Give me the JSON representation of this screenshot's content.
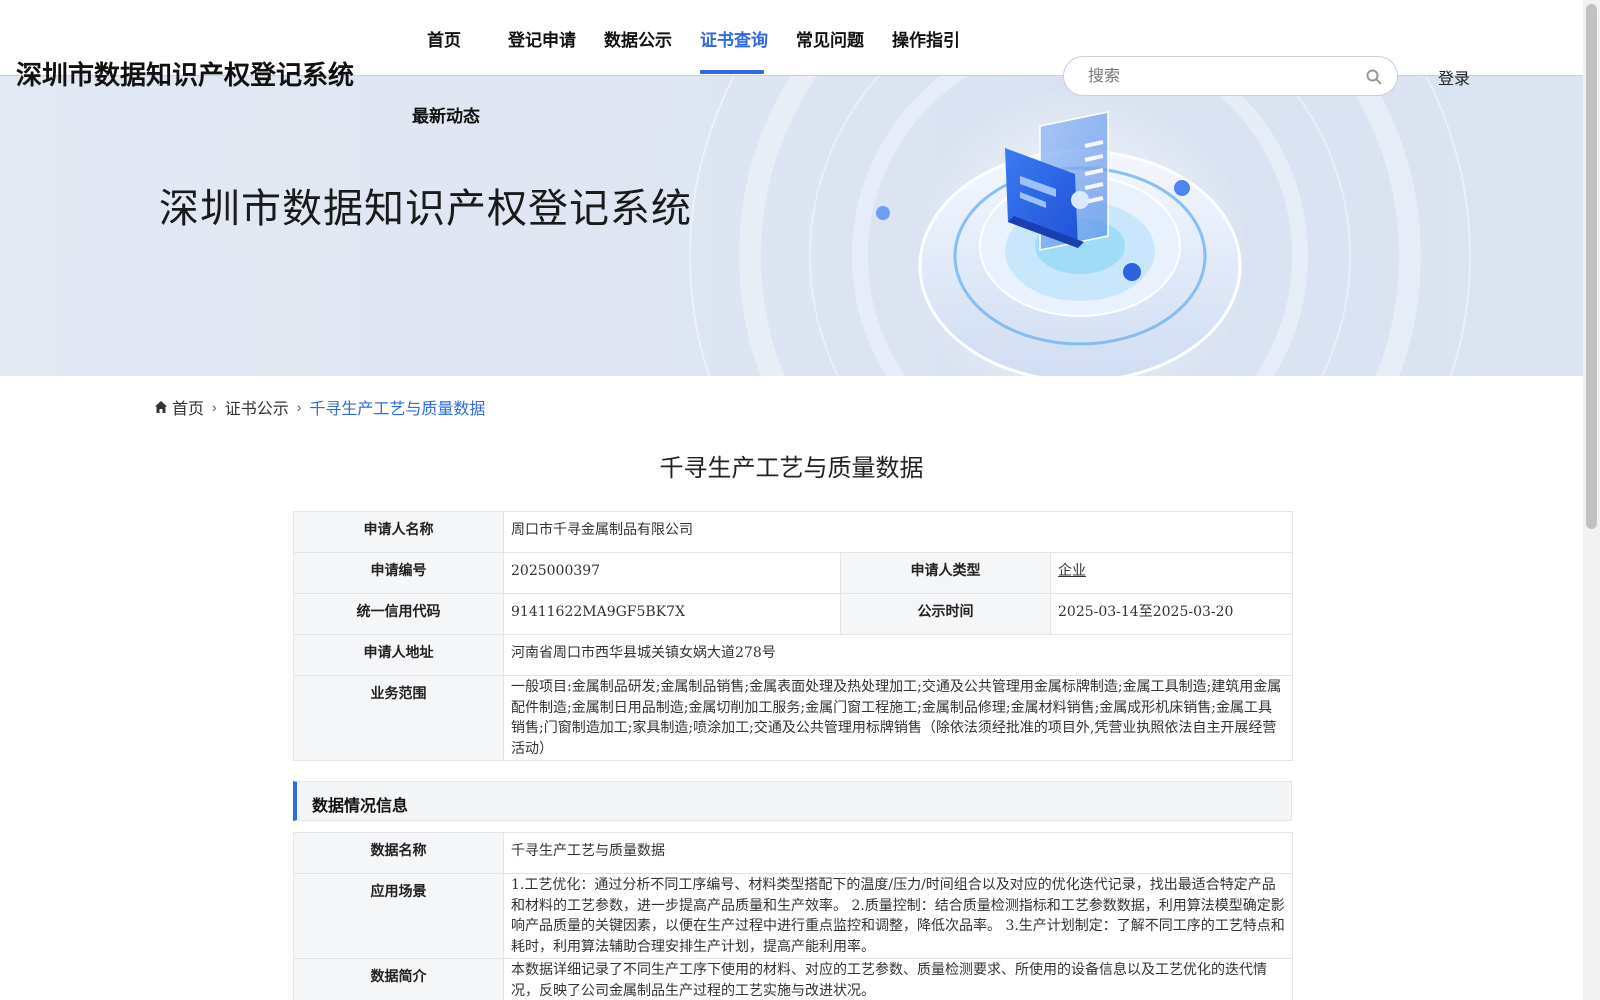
{
  "header": {
    "site_title": "深圳市数据知识产权登记系统",
    "nav": [
      "首页",
      "登记申请",
      "数据公示",
      "证书查询",
      "常见问题",
      "操作指引",
      "最新动态"
    ],
    "active_nav": "证书查询",
    "search_placeholder": "搜索",
    "login": "登录"
  },
  "banner": {
    "title": "深圳市数据知识产权登记系统"
  },
  "breadcrumb": {
    "home": "首页",
    "level2": "证书公示",
    "current": "千寻生产工艺与质量数据"
  },
  "page_title": "千寻生产工艺与质量数据",
  "applicant": {
    "name_label": "申请人名称",
    "name": "周口市千寻金属制品有限公司",
    "number_label": "申请编号",
    "number": "2025000397",
    "type_label": "申请人类型",
    "type": "企业",
    "credit_label": "统一信用代码",
    "credit": "91411622MA9GF5BK7X",
    "period_label": "公示时间",
    "period": "2025-03-14至2025-03-20",
    "address_label": "申请人地址",
    "address": "河南省周口市西华县城关镇女娲大道278号",
    "scope_label": "业务范围",
    "scope": "一般项目:金属制品研发;金属制品销售;金属表面处理及热处理加工;交通及公共管理用金属标牌制造;金属工具制造;建筑用金属配件制造;金属制日用品制造;金属切削加工服务;金属门窗工程施工;金属制品修理;金属材料销售;金属成形机床销售;金属工具销售;门窗制造加工;家具制造;喷涂加工;交通及公共管理用标牌销售（除依法须经批准的项目外,凭营业执照依法自主开展经营活动）"
  },
  "data_section": {
    "heading": "数据情况信息",
    "name_label": "数据名称",
    "name": "千寻生产工艺与质量数据",
    "scenario_label": "应用场景",
    "scenario": "1.工艺优化：通过分析不同工序编号、材料类型搭配下的温度/压力/时间组合以及对应的优化迭代记录，找出最适合特定产品和材料的工艺参数，进一步提高产品质量和生产效率。 2.质量控制：结合质量检测指标和工艺参数数据，利用算法模型确定影响产品质量的关键因素，以便在生产过程中进行重点监控和调整，降低次品率。 3.生产计划制定：了解不同工序的工艺特点和耗时，利用算法辅助合理安排生产计划，提高产能利用率。",
    "intro_label": "数据简介",
    "intro": "本数据详细记录了不同生产工序下使用的材料、对应的工艺参数、质量检测要求、所使用的设备信息以及工艺优化的迭代情况，反映了公司金属制品生产过程的工艺实施与改进状况。"
  },
  "colors": {
    "accent": "#2f6ae0",
    "label_bg": "#f5f6f8",
    "border": "#e2e4e8"
  }
}
